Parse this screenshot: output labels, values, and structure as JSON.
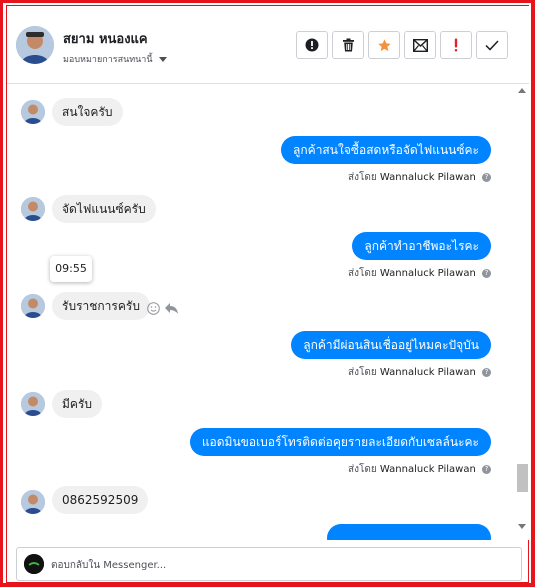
{
  "header": {
    "contact_name": "สยาม หนองแค",
    "assign_label": "มอบหมายการสนทนานี้",
    "actions": [
      {
        "icon": "alert-circle-icon",
        "label": "Mark as spam"
      },
      {
        "icon": "trash-icon",
        "label": "Delete"
      },
      {
        "icon": "star-icon",
        "label": "Star"
      },
      {
        "icon": "mail-icon",
        "label": "Mark unread"
      },
      {
        "icon": "exclamation-icon",
        "label": "Follow up"
      },
      {
        "icon": "check-icon",
        "label": "Mark done"
      }
    ]
  },
  "messages": [
    {
      "from": "customer",
      "text": "สนใจครับ"
    },
    {
      "from": "page",
      "text": "ลูกค้าสนใจซื้อสดหรือจัดไฟแนนซ์คะ",
      "sent_by_prefix": "ส่งโดย",
      "sent_by": "Wannaluck Pilawan"
    },
    {
      "from": "customer",
      "text": "จัดไฟแนนซ์ครับ"
    },
    {
      "from": "page",
      "text": "ลูกค้าทำอาชีพอะไรคะ",
      "sent_by_prefix": "ส่งโดย",
      "sent_by": "Wannaluck Pilawan"
    },
    {
      "from": "customer",
      "text": "รับราชการครับ",
      "tooltip_time": "09:55"
    },
    {
      "from": "page",
      "text": "ลูกค้ามีผ่อนสินเชื่ออยู่ไหมคะปัจุบัน",
      "sent_by_prefix": "ส่งโดย",
      "sent_by": "Wannaluck Pilawan"
    },
    {
      "from": "customer",
      "text": "มีครับ"
    },
    {
      "from": "page",
      "text": "แอดมินขอเบอร์โทรติดต่อคุยรายละเอียดกับเซลล์นะคะ",
      "sent_by_prefix": "ส่งโดย",
      "sent_by": "Wannaluck Pilawan"
    },
    {
      "from": "customer",
      "text": "0862592509"
    }
  ],
  "reply": {
    "placeholder": "ตอบกลับใน Messenger..."
  },
  "colors": {
    "frame": "#e8141c",
    "outgoing_bubble": "#0084ff",
    "incoming_bubble": "#f1f0f0",
    "star_active": "#f7923a",
    "followup": "#e4202b"
  }
}
